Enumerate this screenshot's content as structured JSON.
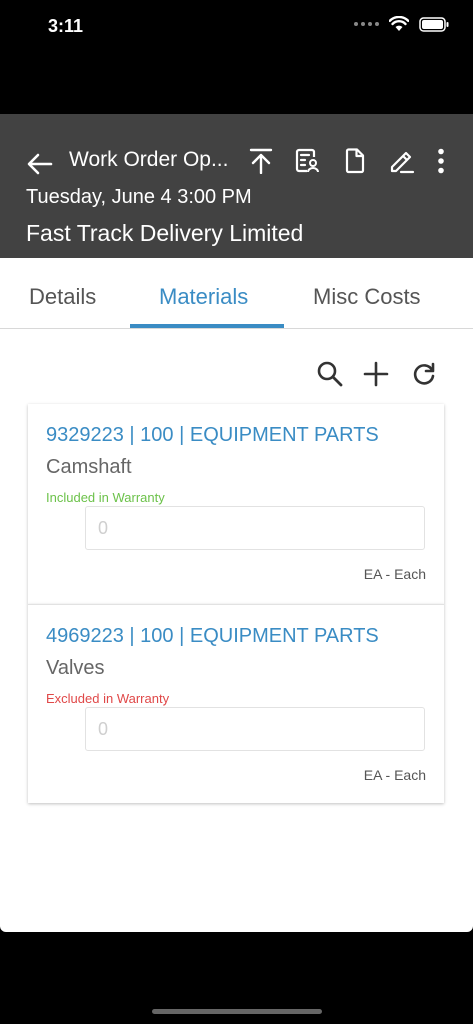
{
  "status_bar": {
    "time": "3:11",
    "icons": [
      "signal-dots-icon",
      "wifi-icon",
      "battery-icon"
    ]
  },
  "header": {
    "title": "Work Order Op...",
    "date": "Tuesday, June 4 3:00 PM",
    "company": "Fast Track Delivery Limited",
    "icons": [
      "back-arrow-icon",
      "upload-icon",
      "checklist-icon",
      "document-icon",
      "edit-icon",
      "more-vert-icon"
    ]
  },
  "tabs": [
    {
      "label": "Details",
      "active": false
    },
    {
      "label": "Materials",
      "active": true
    },
    {
      "label": "Misc Costs",
      "active": false
    }
  ],
  "toolbar": {
    "icons": [
      "search-icon",
      "add-icon",
      "refresh-icon"
    ]
  },
  "materials": [
    {
      "title": "9329223 | 100 | EQUIPMENT PARTS",
      "name": "Camshaft",
      "warranty": "Included in Warranty",
      "quantity_placeholder": "0",
      "uom": "EA - Each"
    },
    {
      "title": "4969223 | 100 | EQUIPMENT PARTS",
      "name": "Valves",
      "warranty": "Excluded in Warranty",
      "quantity_placeholder": "0",
      "uom": "EA - Each"
    }
  ],
  "colors": {
    "header_bg": "#424242",
    "accent": "#3a8cc4",
    "warranty_included": "#6cc24a",
    "warranty_excluded": "#e04848"
  }
}
